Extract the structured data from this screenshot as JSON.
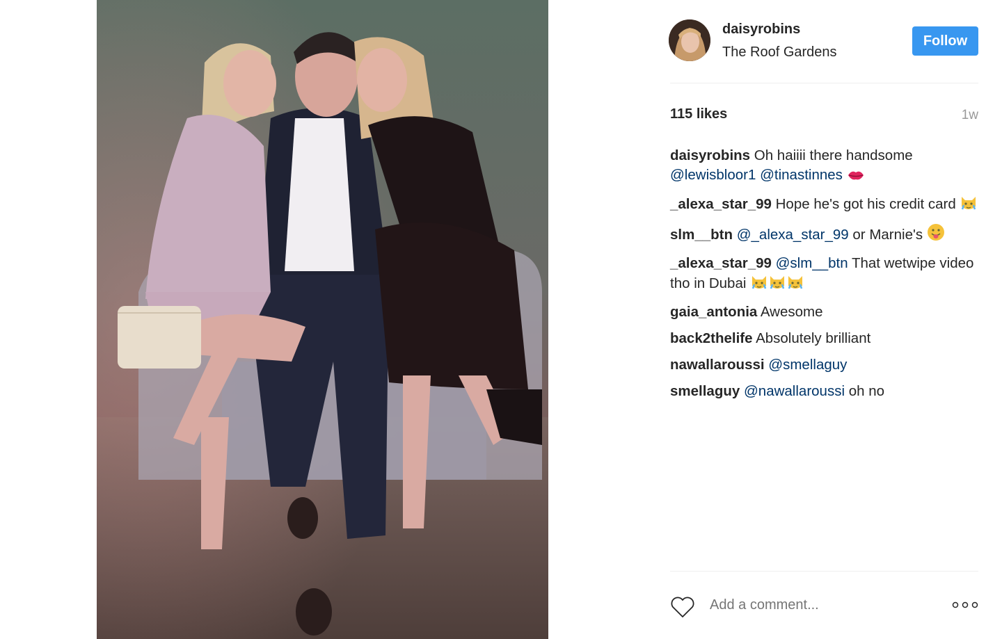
{
  "post": {
    "username": "daisyrobins",
    "location": "The Roof Gardens",
    "follow_label": "Follow",
    "likes": "115 likes",
    "time": "1w",
    "comment_placeholder": "Add a comment..."
  },
  "comments": [
    {
      "user": "daisyrobins",
      "parts": [
        {
          "t": "text",
          "v": " Oh haiiii there handsome "
        },
        {
          "t": "mention",
          "v": "@lewisbloor1"
        },
        {
          "t": "text",
          "v": " "
        },
        {
          "t": "mention",
          "v": "@tinastinnes"
        },
        {
          "t": "text",
          "v": " "
        }
      ],
      "emoji": "kiss-lips-emoji"
    },
    {
      "user": "_alexa_star_99",
      "parts": [
        {
          "t": "text",
          "v": " Hope he's got his credit card "
        }
      ],
      "emoji": "crying-cat-emoji"
    },
    {
      "user": "slm__btn",
      "parts": [
        {
          "t": "text",
          "v": " "
        },
        {
          "t": "mention",
          "v": "@_alexa_star_99"
        },
        {
          "t": "text",
          "v": " or Marnie's "
        }
      ],
      "emoji": "tongue-face-emoji"
    },
    {
      "user": "_alexa_star_99",
      "parts": [
        {
          "t": "text",
          "v": " "
        },
        {
          "t": "mention",
          "v": "@slm__btn"
        },
        {
          "t": "text",
          "v": " That wetwipe video tho in Dubai "
        }
      ],
      "emoji": "crying-cat-emoji-x3"
    },
    {
      "user": "gaia_antonia",
      "parts": [
        {
          "t": "text",
          "v": " Awesome"
        }
      ],
      "emoji": ""
    },
    {
      "user": "back2thelife",
      "parts": [
        {
          "t": "text",
          "v": " Absolutely brilliant"
        }
      ],
      "emoji": ""
    },
    {
      "user": "nawallaroussi",
      "parts": [
        {
          "t": "text",
          "v": " "
        },
        {
          "t": "mention",
          "v": "@smellaguy"
        }
      ],
      "emoji": ""
    },
    {
      "user": "smellaguy",
      "parts": [
        {
          "t": "text",
          "v": " "
        },
        {
          "t": "mention",
          "v": "@nawallaroussi"
        },
        {
          "t": "text",
          "v": " oh no"
        }
      ],
      "emoji": ""
    }
  ],
  "icons": {
    "heart": "heart-outline-icon",
    "more": "more-options-icon"
  },
  "colors": {
    "follow_bg": "#3897f0",
    "mention": "#003569",
    "muted": "#999999"
  }
}
